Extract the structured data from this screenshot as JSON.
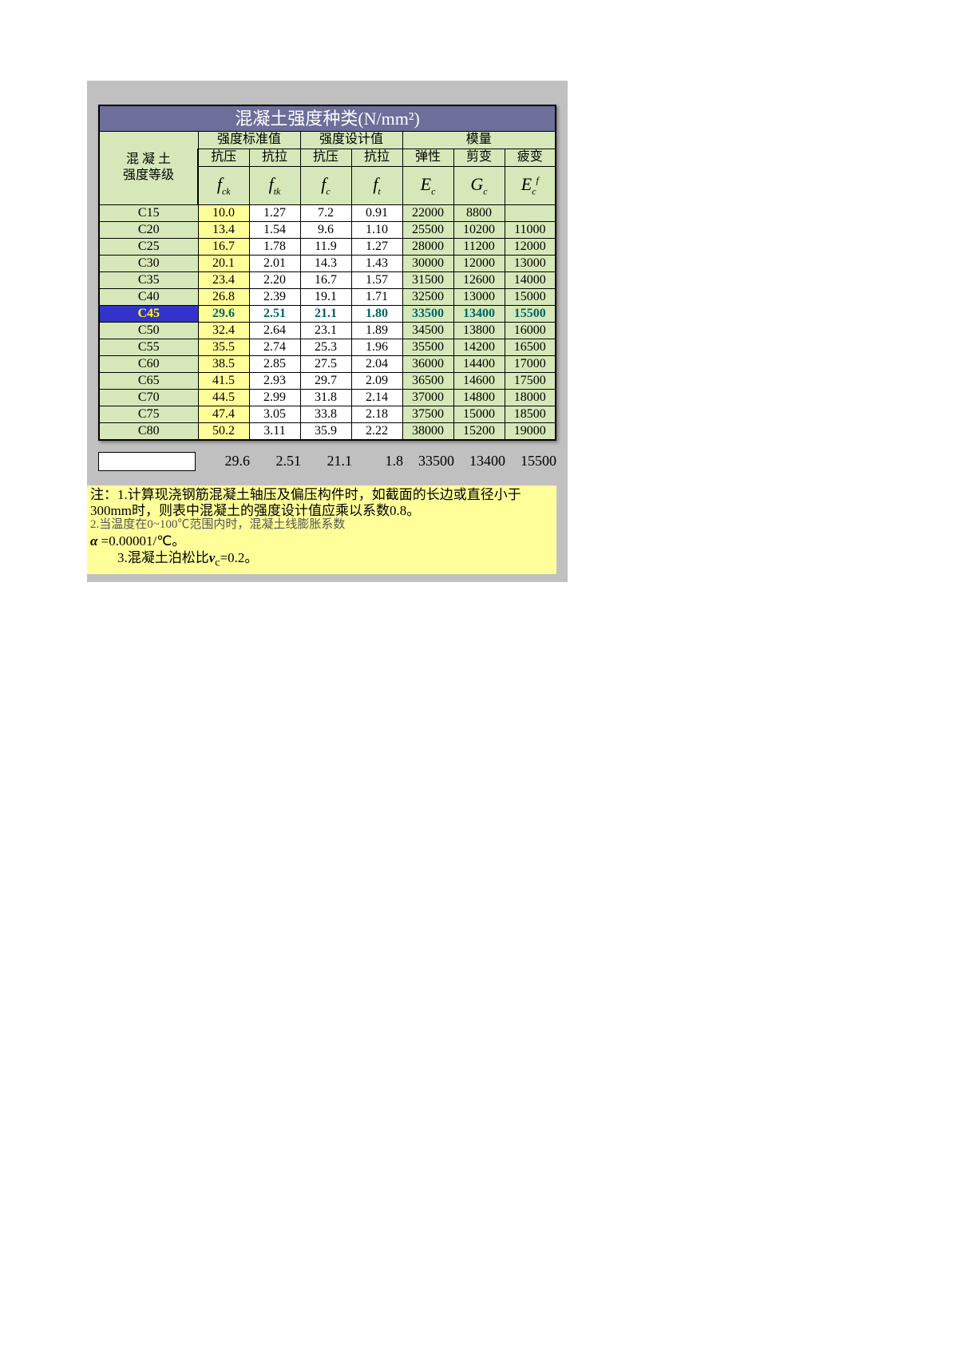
{
  "title": "混凝土强度种类(N/mm²)",
  "header": {
    "row_label_l1": "混 凝 土",
    "row_label_l2": "强度等级",
    "group1": "强度标准值",
    "group2": "强度设计值",
    "group3": "模量",
    "sub": {
      "compress": "抗压",
      "tension": "抗拉",
      "elastic": "弹性",
      "shear": "剪变",
      "fatigue": "疲变"
    }
  },
  "symbols": {
    "fck": "f",
    "fck_sub": "ck",
    "ftk": "f",
    "ftk_sub": "tk",
    "fc": "f",
    "fc_sub": "c",
    "ft": "f",
    "ft_sub": "t",
    "Ec": "E",
    "Ec_sub": "c",
    "Gc": "G",
    "Gc_sub": "c",
    "Ecf": "E",
    "Ecf_sub": "c",
    "Ecf_sup": "f"
  },
  "rows": [
    {
      "grade": "C15",
      "fck": "10.0",
      "ftk": "1.27",
      "fc": "7.2",
      "ft": "0.91",
      "Ec": "22000",
      "Gc": "8800",
      "Ecf": ""
    },
    {
      "grade": "C20",
      "fck": "13.4",
      "ftk": "1.54",
      "fc": "9.6",
      "ft": "1.10",
      "Ec": "25500",
      "Gc": "10200",
      "Ecf": "11000"
    },
    {
      "grade": "C25",
      "fck": "16.7",
      "ftk": "1.78",
      "fc": "11.9",
      "ft": "1.27",
      "Ec": "28000",
      "Gc": "11200",
      "Ecf": "12000"
    },
    {
      "grade": "C30",
      "fck": "20.1",
      "ftk": "2.01",
      "fc": "14.3",
      "ft": "1.43",
      "Ec": "30000",
      "Gc": "12000",
      "Ecf": "13000"
    },
    {
      "grade": "C35",
      "fck": "23.4",
      "ftk": "2.20",
      "fc": "16.7",
      "ft": "1.57",
      "Ec": "31500",
      "Gc": "12600",
      "Ecf": "14000"
    },
    {
      "grade": "C40",
      "fck": "26.8",
      "ftk": "2.39",
      "fc": "19.1",
      "ft": "1.71",
      "Ec": "32500",
      "Gc": "13000",
      "Ecf": "15000"
    },
    {
      "grade": "C45",
      "fck": "29.6",
      "ftk": "2.51",
      "fc": "21.1",
      "ft": "1.80",
      "Ec": "33500",
      "Gc": "13400",
      "Ecf": "15500",
      "highlight": true
    },
    {
      "grade": "C50",
      "fck": "32.4",
      "ftk": "2.64",
      "fc": "23.1",
      "ft": "1.89",
      "Ec": "34500",
      "Gc": "13800",
      "Ecf": "16000"
    },
    {
      "grade": "C55",
      "fck": "35.5",
      "ftk": "2.74",
      "fc": "25.3",
      "ft": "1.96",
      "Ec": "35500",
      "Gc": "14200",
      "Ecf": "16500"
    },
    {
      "grade": "C60",
      "fck": "38.5",
      "ftk": "2.85",
      "fc": "27.5",
      "ft": "2.04",
      "Ec": "36000",
      "Gc": "14400",
      "Ecf": "17000"
    },
    {
      "grade": "C65",
      "fck": "41.5",
      "ftk": "2.93",
      "fc": "29.7",
      "ft": "2.09",
      "Ec": "36500",
      "Gc": "14600",
      "Ecf": "17500"
    },
    {
      "grade": "C70",
      "fck": "44.5",
      "ftk": "2.99",
      "fc": "31.8",
      "ft": "2.14",
      "Ec": "37000",
      "Gc": "14800",
      "Ecf": "18000"
    },
    {
      "grade": "C75",
      "fck": "47.4",
      "ftk": "3.05",
      "fc": "33.8",
      "ft": "2.18",
      "Ec": "37500",
      "Gc": "15000",
      "Ecf": "18500"
    },
    {
      "grade": "C80",
      "fck": "50.2",
      "ftk": "3.11",
      "fc": "35.9",
      "ft": "2.22",
      "Ec": "38000",
      "Gc": "15200",
      "Ecf": "19000"
    }
  ],
  "output_row": {
    "fck": "29.6",
    "ftk": "2.51",
    "fc": "21.1",
    "ft": "1.8",
    "Ec": "33500",
    "Gc": "13400",
    "Ecf": "15500"
  },
  "notes": {
    "line1": "注：1.计算现浇钢筋混凝土轴压及偏压构件时，如截面的长边或直径小于300mm时，则表中混凝土的强度设计值应乘以系数0.8。",
    "line2_garbled": "2.当温度在0~100℃范围内时，混凝土线膨胀系数",
    "alpha_label": "α",
    "alpha_value": " =0.00001/℃。",
    "line3_prefix": "　　3.混凝土泊松比",
    "nu": "ν",
    "nu_sub": "c",
    "line3_suffix": "=0.2。"
  }
}
